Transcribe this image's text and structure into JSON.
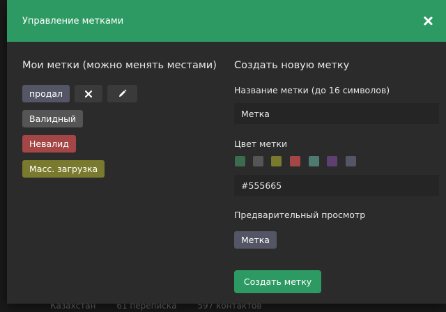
{
  "backdrop": {
    "country": "Казахстан",
    "chats": "61 переписка",
    "contacts": "597 контактов"
  },
  "modal": {
    "title": "Управление метками",
    "close_icon": "close-icon"
  },
  "my_tags": {
    "title": "Мои метки (можно менять местами)",
    "items": [
      {
        "label": "продал",
        "color": "#555665"
      },
      {
        "label": "Валидный",
        "color": "#555555"
      },
      {
        "label": "Невалид",
        "color": "#a54646"
      },
      {
        "label": "Масс. загрузка",
        "color": "#7a7a2e"
      }
    ],
    "delete_icon": "close-icon",
    "edit_icon": "pencil-icon"
  },
  "new_tag": {
    "title": "Создать новую метку",
    "name_label": "Название метки (до 16 символов)",
    "name_value": "Метка",
    "color_label": "Цвет метки",
    "swatches": [
      "#3d6b4e",
      "#555555",
      "#7a7a2e",
      "#a54646",
      "#4f7a72",
      "#5d3f72",
      "#555665"
    ],
    "color_value": "#555665",
    "preview_label": "Предварительный просмотр",
    "preview_tag": "Метка",
    "create_button": "Создать метку"
  },
  "colors": {
    "header": "#2e9a63",
    "modal_bg": "#2b2b2b",
    "input_bg": "#252525"
  }
}
